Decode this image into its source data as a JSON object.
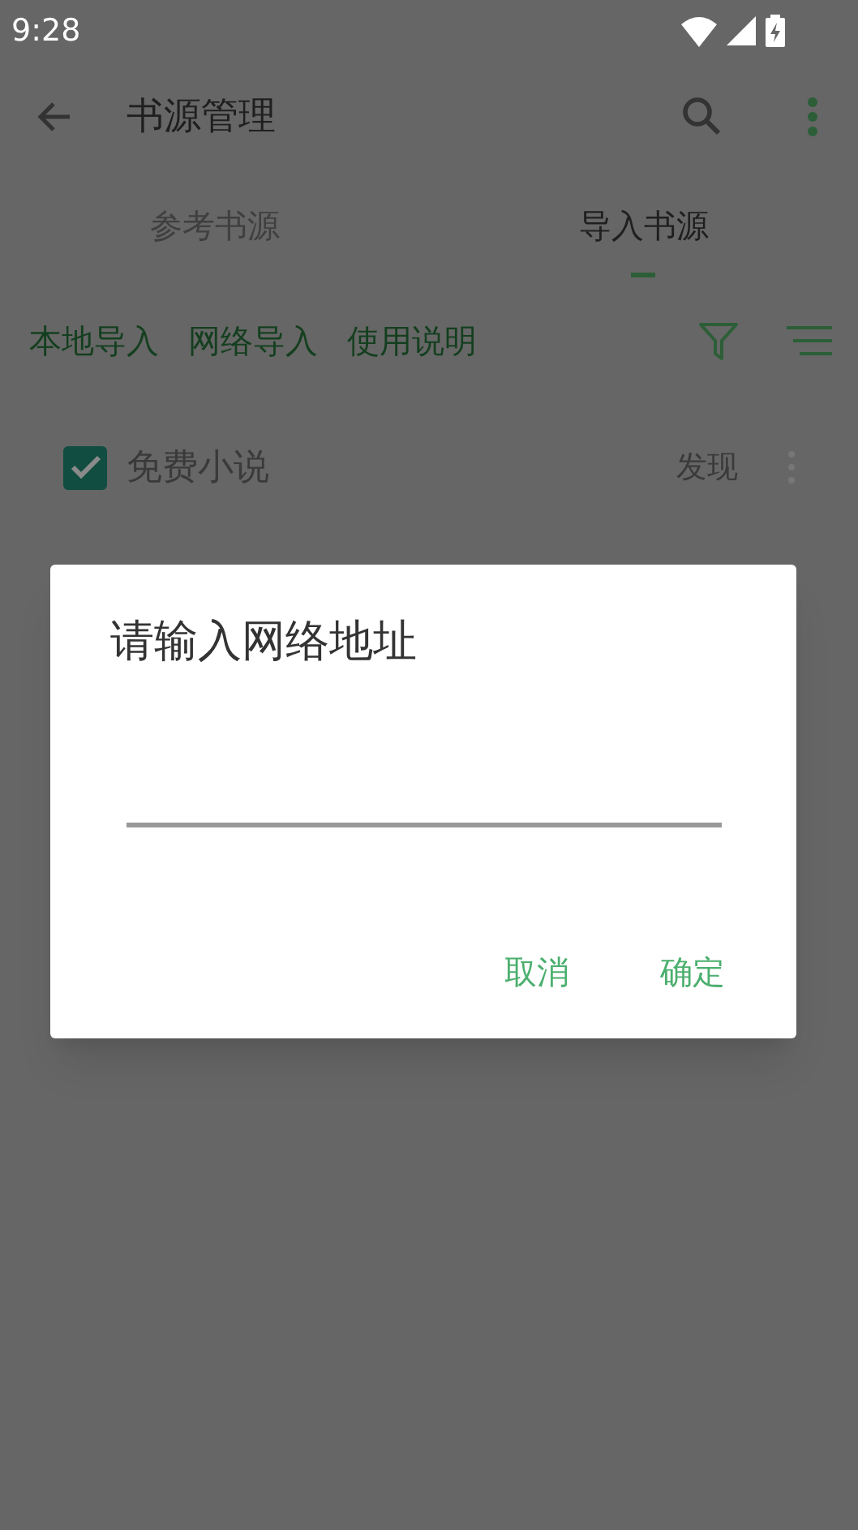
{
  "status_bar": {
    "time": "9:28"
  },
  "toolbar": {
    "title": "书源管理"
  },
  "tabs": [
    {
      "label": "参考书源",
      "selected": false
    },
    {
      "label": "导入书源",
      "selected": true
    }
  ],
  "actions": [
    "本地导入",
    "网络导入",
    "使用说明"
  ],
  "sources": [
    {
      "name": "免费小说",
      "checked": true,
      "tag": "发现"
    }
  ],
  "dialog": {
    "title": "请输入网络地址",
    "buttons": [
      "取消",
      "确定"
    ]
  }
}
